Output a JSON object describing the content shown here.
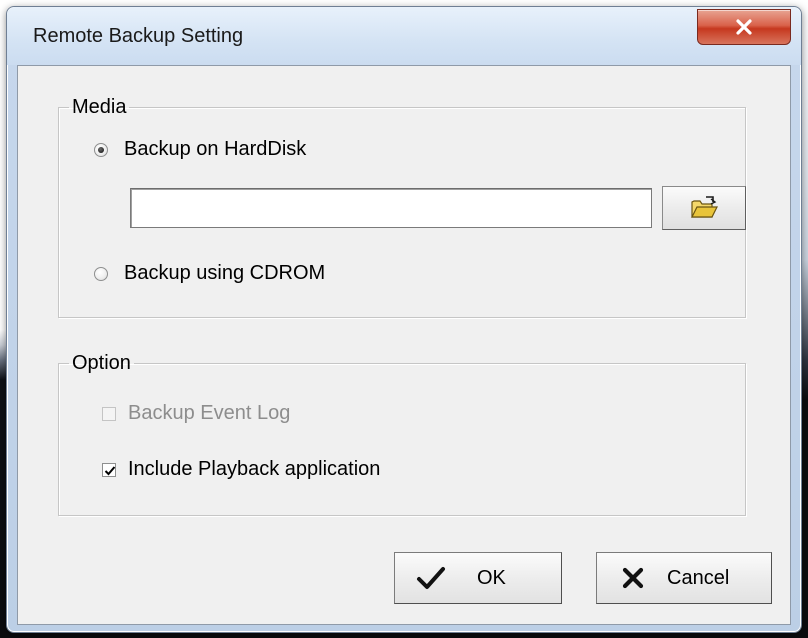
{
  "window": {
    "title": "Remote Backup Setting",
    "close_label": "X"
  },
  "media": {
    "legend": "Media",
    "options": [
      {
        "label": "Backup on HardDisk",
        "checked": true
      },
      {
        "label": "Backup using CDROM",
        "checked": false
      }
    ],
    "path_value": "",
    "path_placeholder": "",
    "browse_icon": "open-folder-icon"
  },
  "option": {
    "legend": "Option",
    "items": [
      {
        "label": "Backup Event Log",
        "checked": false,
        "enabled": false
      },
      {
        "label": "Include Playback application",
        "checked": true,
        "enabled": true
      }
    ]
  },
  "buttons": {
    "ok_label": "OK",
    "ok_icon": "checkmark-icon",
    "cancel_label": "Cancel",
    "cancel_icon": "cross-icon"
  },
  "colors": {
    "close_button": "#c6381f",
    "folder_icon": "#e8c43a",
    "title_bar": "#d4e3f4",
    "client_bg": "#f0f0f0"
  }
}
